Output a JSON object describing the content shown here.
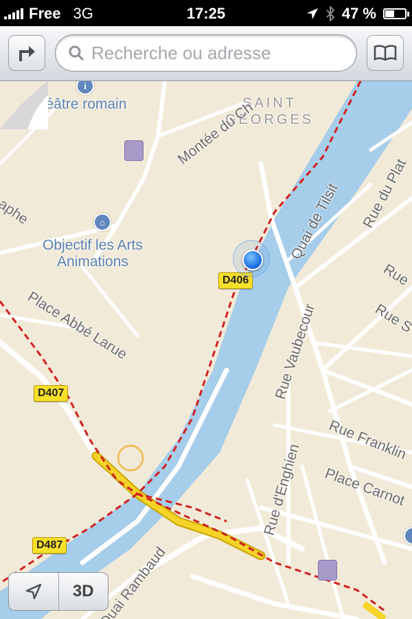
{
  "status_bar": {
    "carrier": "Free",
    "network": "3G",
    "time": "17:25",
    "battery": "47 %",
    "battery_level": 0.47
  },
  "toolbar": {
    "search_placeholder": "Recherche ou adresse",
    "directions_icon": "turn-right-arrow-icon",
    "bookmarks_icon": "open-book-icon"
  },
  "map": {
    "district": "SAINT\nGEORGES",
    "pois": {
      "theatre": "Théâtre romain",
      "museum": "Objectif les Arts\nAnimations"
    },
    "streets": {
      "montee": "Montée du Ch",
      "aphe": "aphe",
      "place_abbe": "Place Abbé Larue",
      "quai_tilsit": "Quai de Tilsit",
      "rue_plat": "Rue du Plat",
      "rue_r": "Rue",
      "rue_s": "Rue S",
      "rue_vaubecour": "Rue Vaubecour",
      "rue_franklin": "Rue Franklin",
      "place_carnot": "Place Carnot",
      "rue_enghien": "Rue d'Enghien",
      "quai_rambaud": "Quai Rambaud"
    },
    "road_shields": {
      "d406": "D406",
      "d407": "D407",
      "d487": "D487"
    },
    "colors": {
      "land": "#f2ead8",
      "water": "#a6cdea",
      "road": "#ffffff",
      "highway": "#f5d328",
      "rail": "#d22020"
    }
  },
  "controls": {
    "three_d_label": "3D",
    "locate_icon": "location-arrow-icon"
  }
}
